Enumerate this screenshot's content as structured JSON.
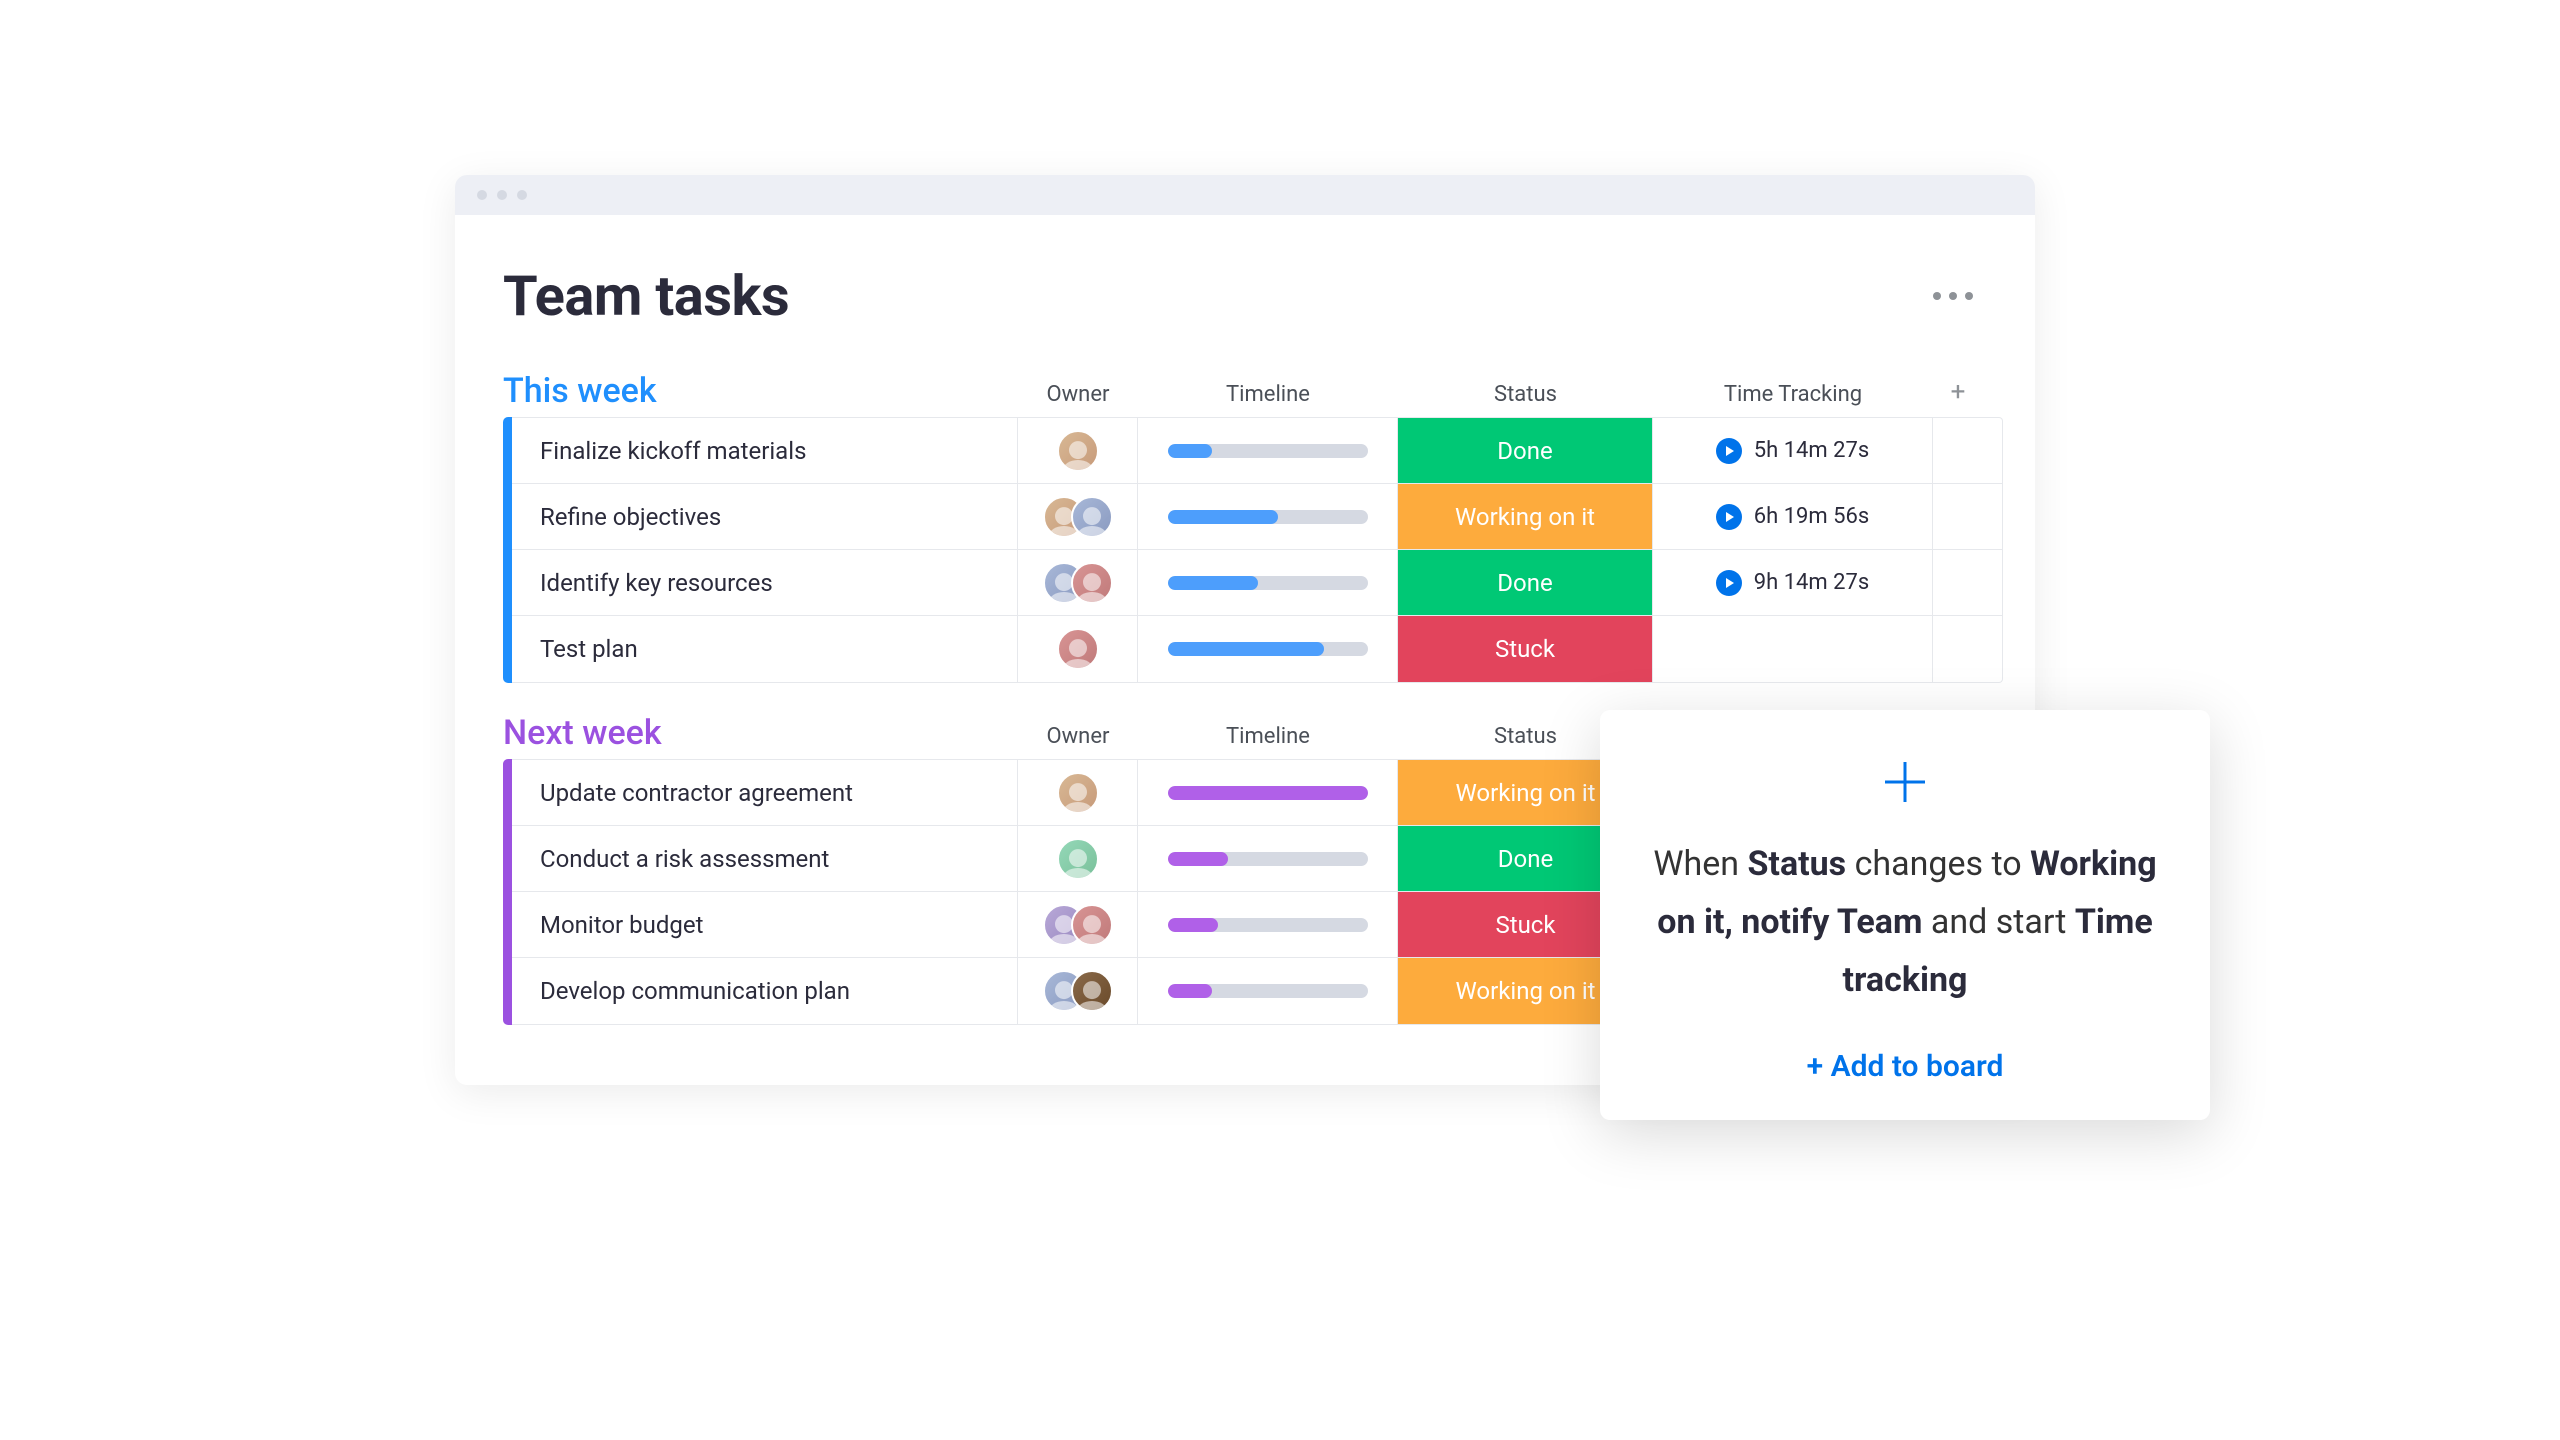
{
  "board_title": "Team tasks",
  "columns": {
    "owner": "Owner",
    "timeline": "Timeline",
    "status": "Status",
    "time_tracking": "Time Tracking",
    "plus": "+"
  },
  "status_labels": {
    "done": "Done",
    "working": "Working on it",
    "stuck": "Stuck"
  },
  "groups": [
    {
      "title": "This week",
      "color": "blue",
      "show_time": true,
      "rows": [
        {
          "name": "Finalize kickoff materials",
          "owners": [
            "a1"
          ],
          "progress": 22,
          "status": "done",
          "time": "5h 14m 27s"
        },
        {
          "name": "Refine objectives",
          "owners": [
            "a1",
            "a2"
          ],
          "progress": 55,
          "status": "working",
          "time": "6h 19m 56s"
        },
        {
          "name": "Identify key resources",
          "owners": [
            "a2",
            "a3"
          ],
          "progress": 45,
          "status": "done",
          "time": "9h 14m 27s"
        },
        {
          "name": "Test plan",
          "owners": [
            "a3"
          ],
          "progress": 78,
          "status": "stuck",
          "time": ""
        }
      ]
    },
    {
      "title": "Next week",
      "color": "purple",
      "show_time": false,
      "rows": [
        {
          "name": "Update contractor agreement",
          "owners": [
            "a1"
          ],
          "progress": 100,
          "status": "working",
          "time": ""
        },
        {
          "name": "Conduct a risk assessment",
          "owners": [
            "a4"
          ],
          "progress": 30,
          "status": "done",
          "time": ""
        },
        {
          "name": "Monitor budget",
          "owners": [
            "a5",
            "a3"
          ],
          "progress": 25,
          "status": "stuck",
          "time": ""
        },
        {
          "name": "Develop communication plan",
          "owners": [
            "a2",
            "a6"
          ],
          "progress": 22,
          "status": "working",
          "time": ""
        }
      ]
    }
  ],
  "automation": {
    "parts": [
      "When ",
      "Status",
      " changes to ",
      "Working on it, notify Team",
      " and start ",
      "Time tracking"
    ],
    "add_label": "+ Add to board"
  }
}
